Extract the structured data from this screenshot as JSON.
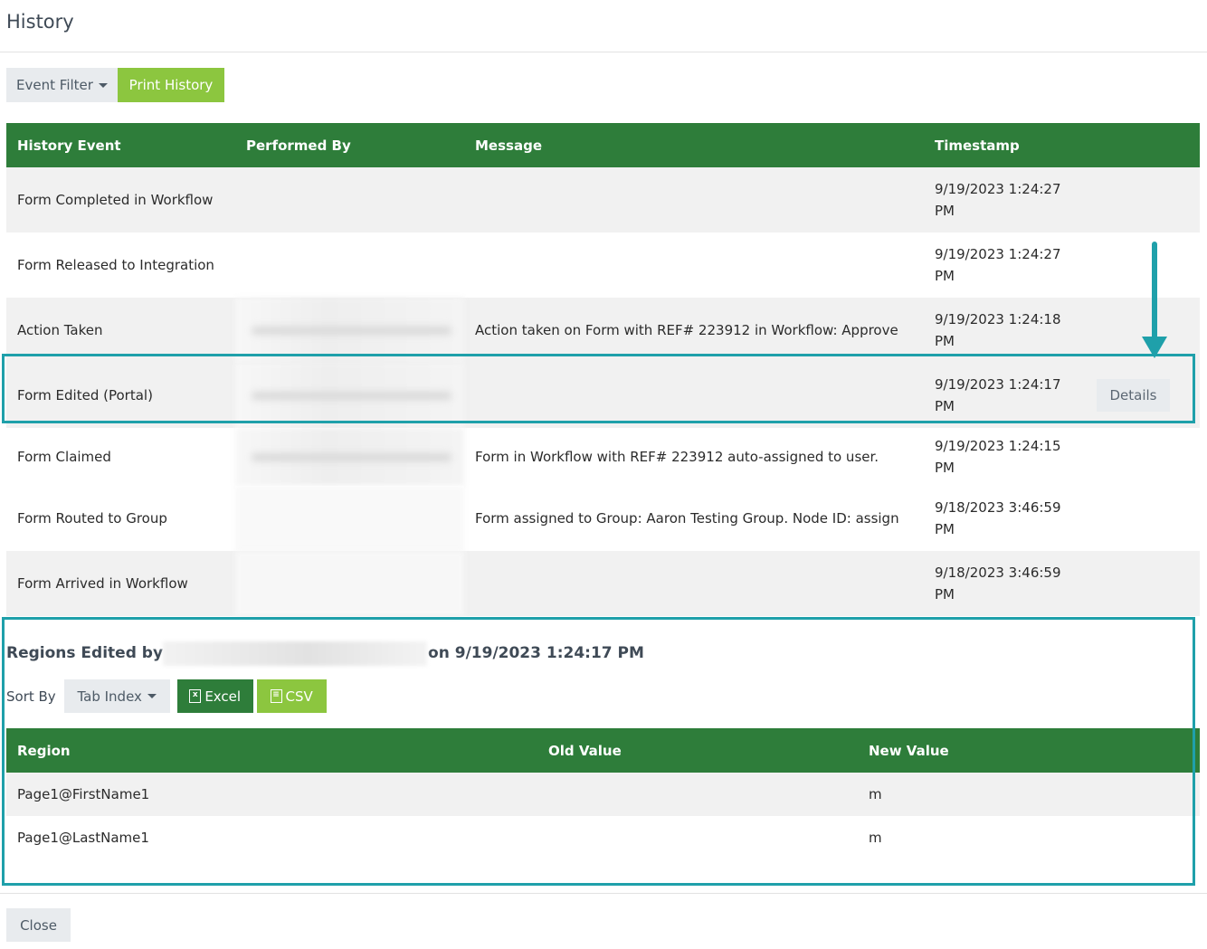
{
  "modal": {
    "title": "History"
  },
  "toolbar": {
    "event_filter_label": "Event Filter",
    "print_history_label": "Print History"
  },
  "history_table": {
    "columns": [
      "History Event",
      "Performed By",
      "Message",
      "Timestamp"
    ],
    "rows": [
      {
        "event": "Form Completed in Workflow",
        "message": "",
        "timestamp": "9/19/2023 1:24:27 PM"
      },
      {
        "event": "Form Released to Integration",
        "message": "",
        "timestamp": "9/19/2023 1:24:27 PM"
      },
      {
        "event": "Action Taken",
        "message": "Action taken on Form with REF# 223912 in Workflow: Approve",
        "timestamp": "9/19/2023 1:24:18 PM"
      },
      {
        "event": "Form Edited (Portal)",
        "message": "",
        "timestamp": "9/19/2023 1:24:17 PM",
        "action_label": "Details"
      },
      {
        "event": "Form Claimed",
        "message": "Form in Workflow with REF# 223912 auto-assigned to user.",
        "timestamp": "9/19/2023 1:24:15 PM"
      },
      {
        "event": "Form Routed to Group",
        "message": "Form assigned to Group: Aaron Testing Group. Node ID: assign",
        "timestamp": "9/18/2023 3:46:59 PM"
      },
      {
        "event": "Form Arrived in Workflow",
        "message": "",
        "timestamp": "9/18/2023 3:46:59 PM"
      }
    ]
  },
  "regions_panel": {
    "heading_prefix": "Regions Edited by",
    "heading_suffix": "on 9/19/2023 1:24:17 PM",
    "sort_by_label": "Sort By",
    "sort_value": "Tab Index",
    "excel_label": "Excel",
    "csv_label": "CSV",
    "columns": [
      "Region",
      "Old Value",
      "New Value"
    ],
    "rows": [
      {
        "region": "Page1@FirstName1",
        "old_value": "",
        "new_value": "m"
      },
      {
        "region": "Page1@LastName1",
        "old_value": "",
        "new_value": "m"
      }
    ]
  },
  "footer": {
    "close_label": "Close"
  },
  "colors": {
    "header_green": "#2e7d3a",
    "accent_lime": "#8cc63f",
    "highlight_teal": "#1fa0aa"
  }
}
